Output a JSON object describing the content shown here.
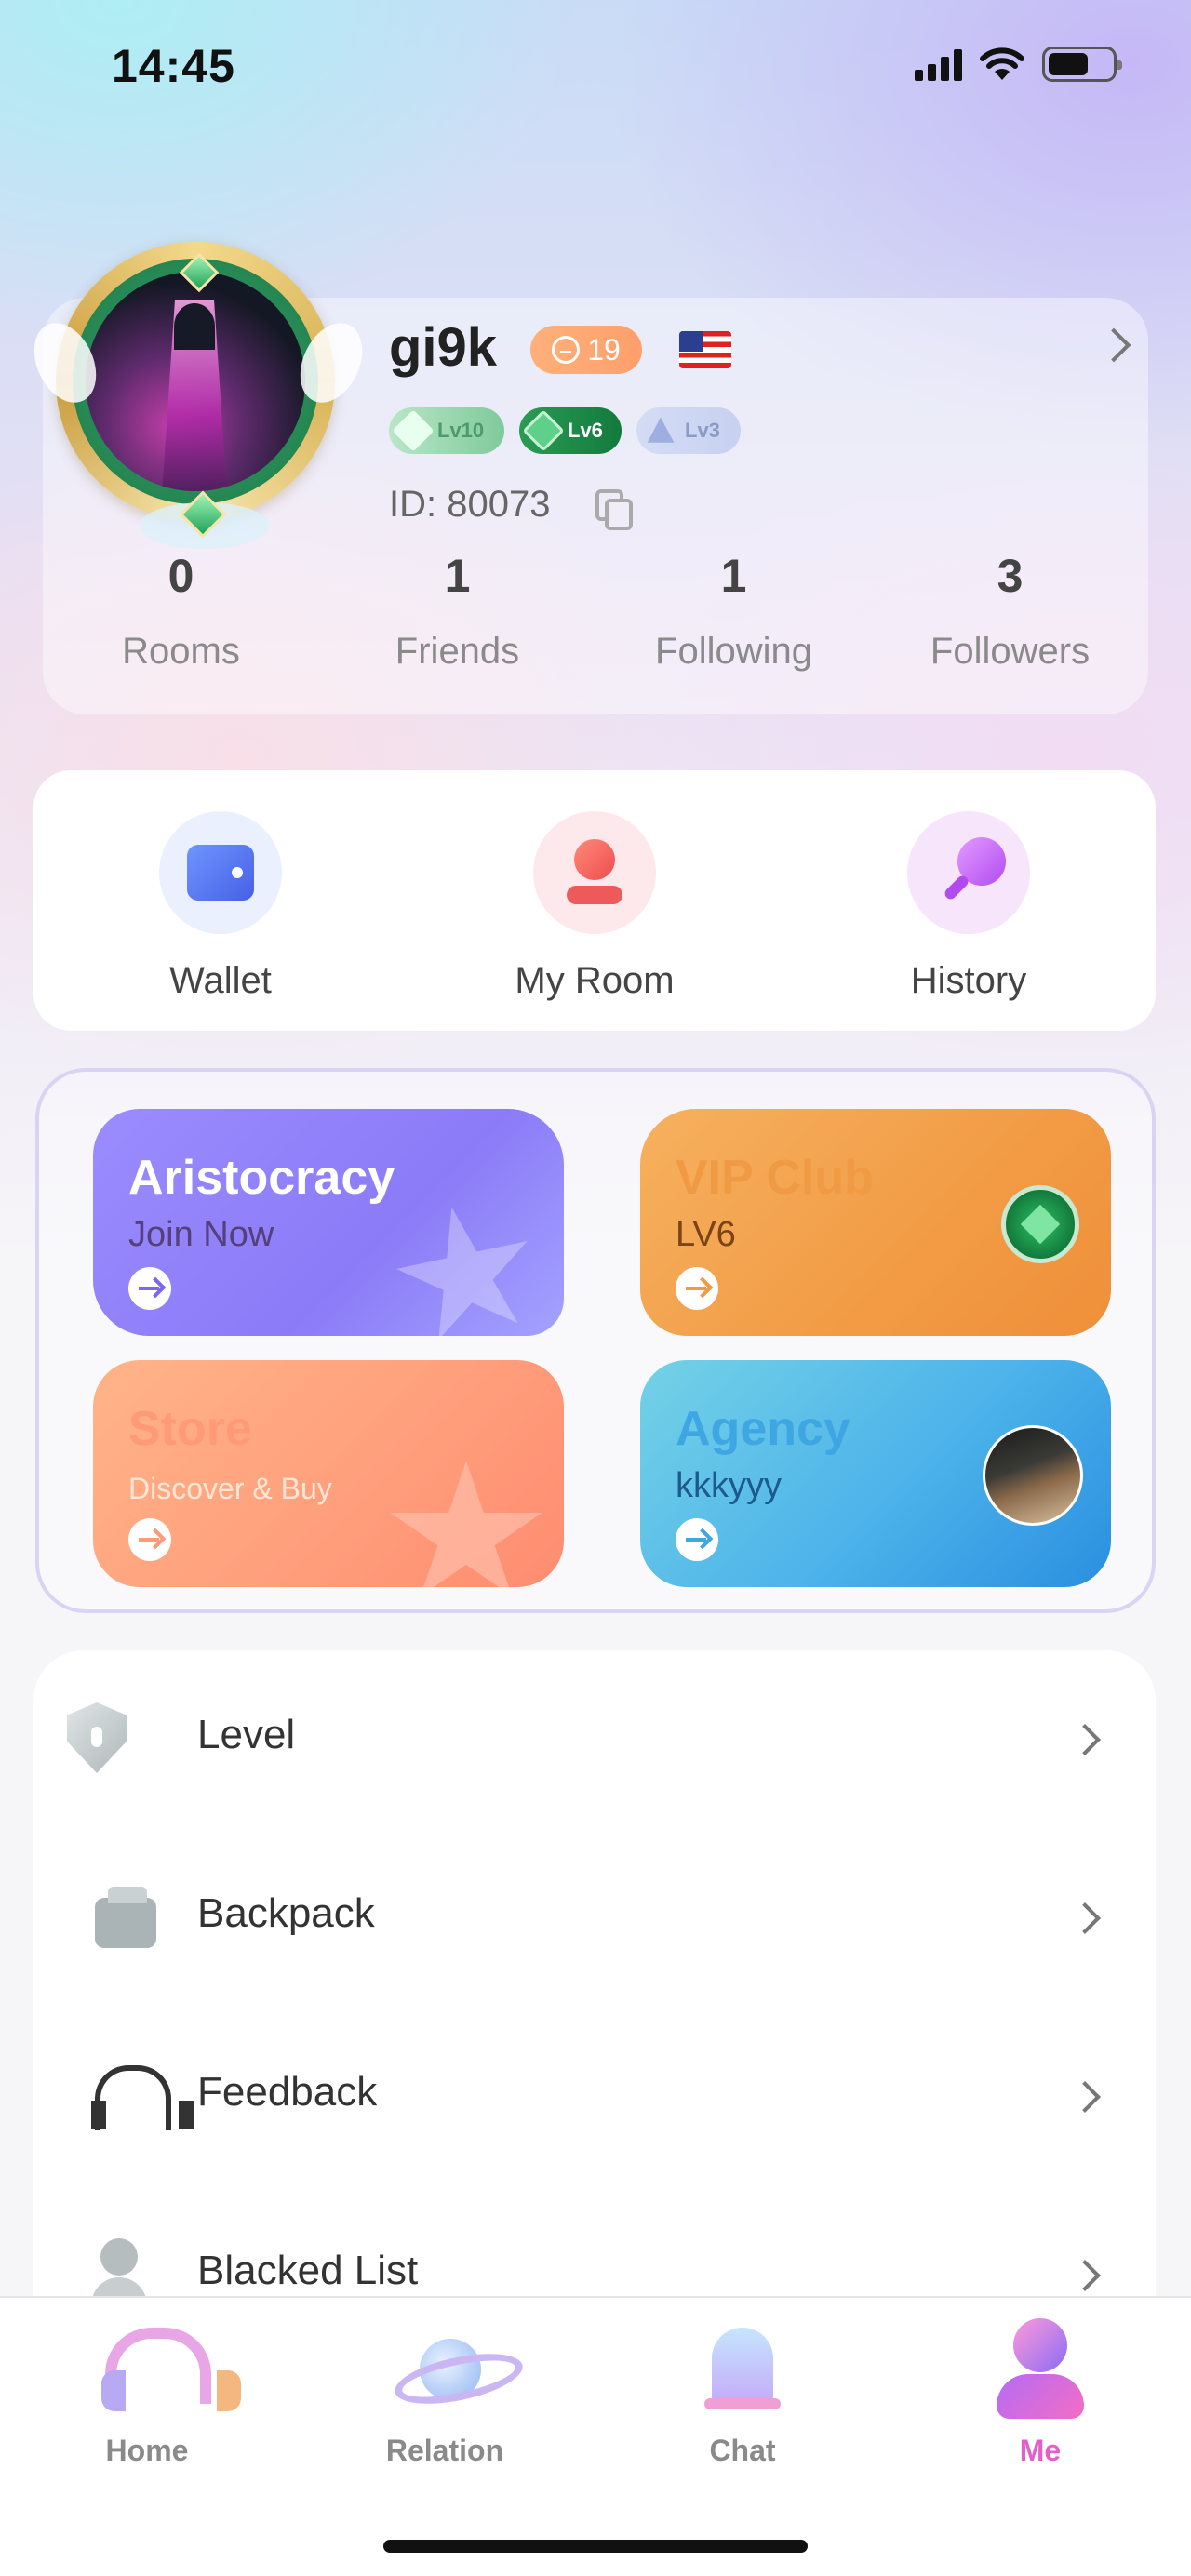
{
  "status_bar": {
    "time": "14:45"
  },
  "profile": {
    "username": "gi9k",
    "age": "19",
    "levels": [
      "Lv10",
      "Lv6",
      "Lv3"
    ],
    "id_text": "ID: 80073",
    "stats": [
      {
        "value": "0",
        "label": "Rooms"
      },
      {
        "value": "1",
        "label": "Friends"
      },
      {
        "value": "1",
        "label": "Following"
      },
      {
        "value": "3",
        "label": "Followers"
      }
    ]
  },
  "quick_actions": [
    {
      "label": "Wallet",
      "icon": "wallet-icon"
    },
    {
      "label": "My Room",
      "icon": "my-room-icon"
    },
    {
      "label": "History",
      "icon": "history-icon"
    }
  ],
  "features": {
    "aristocracy": {
      "title": "Aristocracy",
      "subtitle": "Join Now"
    },
    "vip": {
      "title": "VIP Club",
      "subtitle": "LV6"
    },
    "store": {
      "title": "Store",
      "subtitle": "Discover & Buy"
    },
    "agency": {
      "title": "Agency",
      "subtitle": "kkkyyy"
    }
  },
  "menu": [
    {
      "label": "Level",
      "icon": "shield-icon"
    },
    {
      "label": "Backpack",
      "icon": "backpack-icon"
    },
    {
      "label": "Feedback",
      "icon": "headphones-icon"
    },
    {
      "label": "Blacked List",
      "icon": "blocked-user-icon"
    }
  ],
  "bottom_nav": [
    {
      "label": "Home",
      "icon": "headphones-icon"
    },
    {
      "label": "Relation",
      "icon": "planet-icon"
    },
    {
      "label": "Chat",
      "icon": "bell-icon"
    },
    {
      "label": "Me",
      "icon": "user-icon",
      "active": true
    }
  ],
  "colors": {
    "active_tab": "#e35fc8",
    "vip_orange": "#f29b45",
    "aristocracy_purple": "#8b7bf7",
    "agency_blue": "#4db3ea"
  }
}
